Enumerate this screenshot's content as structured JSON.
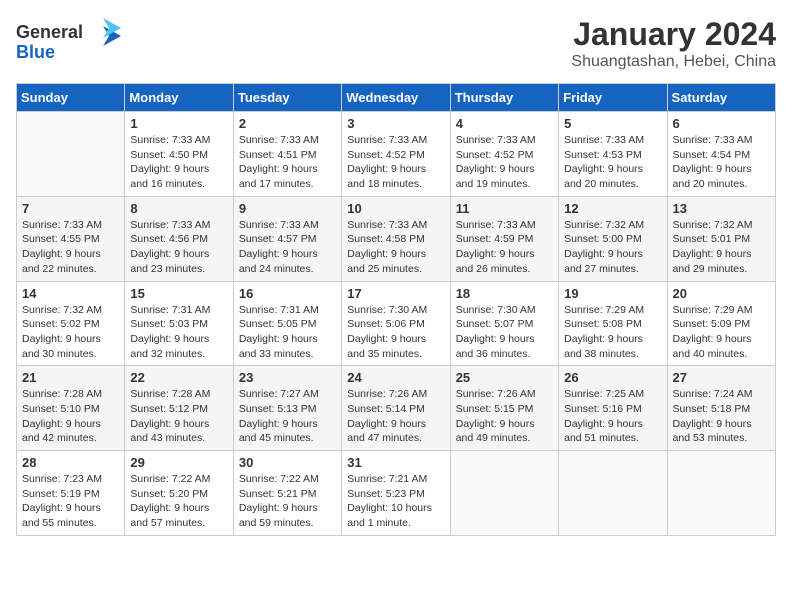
{
  "header": {
    "logo": {
      "general": "General",
      "blue": "Blue"
    },
    "month": "January 2024",
    "location": "Shuangtashan, Hebei, China"
  },
  "calendar": {
    "days_of_week": [
      "Sunday",
      "Monday",
      "Tuesday",
      "Wednesday",
      "Thursday",
      "Friday",
      "Saturday"
    ],
    "weeks": [
      [
        {
          "day": "",
          "info": ""
        },
        {
          "day": "1",
          "info": "Sunrise: 7:33 AM\nSunset: 4:50 PM\nDaylight: 9 hours\nand 16 minutes."
        },
        {
          "day": "2",
          "info": "Sunrise: 7:33 AM\nSunset: 4:51 PM\nDaylight: 9 hours\nand 17 minutes."
        },
        {
          "day": "3",
          "info": "Sunrise: 7:33 AM\nSunset: 4:52 PM\nDaylight: 9 hours\nand 18 minutes."
        },
        {
          "day": "4",
          "info": "Sunrise: 7:33 AM\nSunset: 4:52 PM\nDaylight: 9 hours\nand 19 minutes."
        },
        {
          "day": "5",
          "info": "Sunrise: 7:33 AM\nSunset: 4:53 PM\nDaylight: 9 hours\nand 20 minutes."
        },
        {
          "day": "6",
          "info": "Sunrise: 7:33 AM\nSunset: 4:54 PM\nDaylight: 9 hours\nand 20 minutes."
        }
      ],
      [
        {
          "day": "7",
          "info": "Sunrise: 7:33 AM\nSunset: 4:55 PM\nDaylight: 9 hours\nand 22 minutes."
        },
        {
          "day": "8",
          "info": "Sunrise: 7:33 AM\nSunset: 4:56 PM\nDaylight: 9 hours\nand 23 minutes."
        },
        {
          "day": "9",
          "info": "Sunrise: 7:33 AM\nSunset: 4:57 PM\nDaylight: 9 hours\nand 24 minutes."
        },
        {
          "day": "10",
          "info": "Sunrise: 7:33 AM\nSunset: 4:58 PM\nDaylight: 9 hours\nand 25 minutes."
        },
        {
          "day": "11",
          "info": "Sunrise: 7:33 AM\nSunset: 4:59 PM\nDaylight: 9 hours\nand 26 minutes."
        },
        {
          "day": "12",
          "info": "Sunrise: 7:32 AM\nSunset: 5:00 PM\nDaylight: 9 hours\nand 27 minutes."
        },
        {
          "day": "13",
          "info": "Sunrise: 7:32 AM\nSunset: 5:01 PM\nDaylight: 9 hours\nand 29 minutes."
        }
      ],
      [
        {
          "day": "14",
          "info": "Sunrise: 7:32 AM\nSunset: 5:02 PM\nDaylight: 9 hours\nand 30 minutes."
        },
        {
          "day": "15",
          "info": "Sunrise: 7:31 AM\nSunset: 5:03 PM\nDaylight: 9 hours\nand 32 minutes."
        },
        {
          "day": "16",
          "info": "Sunrise: 7:31 AM\nSunset: 5:05 PM\nDaylight: 9 hours\nand 33 minutes."
        },
        {
          "day": "17",
          "info": "Sunrise: 7:30 AM\nSunset: 5:06 PM\nDaylight: 9 hours\nand 35 minutes."
        },
        {
          "day": "18",
          "info": "Sunrise: 7:30 AM\nSunset: 5:07 PM\nDaylight: 9 hours\nand 36 minutes."
        },
        {
          "day": "19",
          "info": "Sunrise: 7:29 AM\nSunset: 5:08 PM\nDaylight: 9 hours\nand 38 minutes."
        },
        {
          "day": "20",
          "info": "Sunrise: 7:29 AM\nSunset: 5:09 PM\nDaylight: 9 hours\nand 40 minutes."
        }
      ],
      [
        {
          "day": "21",
          "info": "Sunrise: 7:28 AM\nSunset: 5:10 PM\nDaylight: 9 hours\nand 42 minutes."
        },
        {
          "day": "22",
          "info": "Sunrise: 7:28 AM\nSunset: 5:12 PM\nDaylight: 9 hours\nand 43 minutes."
        },
        {
          "day": "23",
          "info": "Sunrise: 7:27 AM\nSunset: 5:13 PM\nDaylight: 9 hours\nand 45 minutes."
        },
        {
          "day": "24",
          "info": "Sunrise: 7:26 AM\nSunset: 5:14 PM\nDaylight: 9 hours\nand 47 minutes."
        },
        {
          "day": "25",
          "info": "Sunrise: 7:26 AM\nSunset: 5:15 PM\nDaylight: 9 hours\nand 49 minutes."
        },
        {
          "day": "26",
          "info": "Sunrise: 7:25 AM\nSunset: 5:16 PM\nDaylight: 9 hours\nand 51 minutes."
        },
        {
          "day": "27",
          "info": "Sunrise: 7:24 AM\nSunset: 5:18 PM\nDaylight: 9 hours\nand 53 minutes."
        }
      ],
      [
        {
          "day": "28",
          "info": "Sunrise: 7:23 AM\nSunset: 5:19 PM\nDaylight: 9 hours\nand 55 minutes."
        },
        {
          "day": "29",
          "info": "Sunrise: 7:22 AM\nSunset: 5:20 PM\nDaylight: 9 hours\nand 57 minutes."
        },
        {
          "day": "30",
          "info": "Sunrise: 7:22 AM\nSunset: 5:21 PM\nDaylight: 9 hours\nand 59 minutes."
        },
        {
          "day": "31",
          "info": "Sunrise: 7:21 AM\nSunset: 5:23 PM\nDaylight: 10 hours\nand 1 minute."
        },
        {
          "day": "",
          "info": ""
        },
        {
          "day": "",
          "info": ""
        },
        {
          "day": "",
          "info": ""
        }
      ]
    ]
  }
}
